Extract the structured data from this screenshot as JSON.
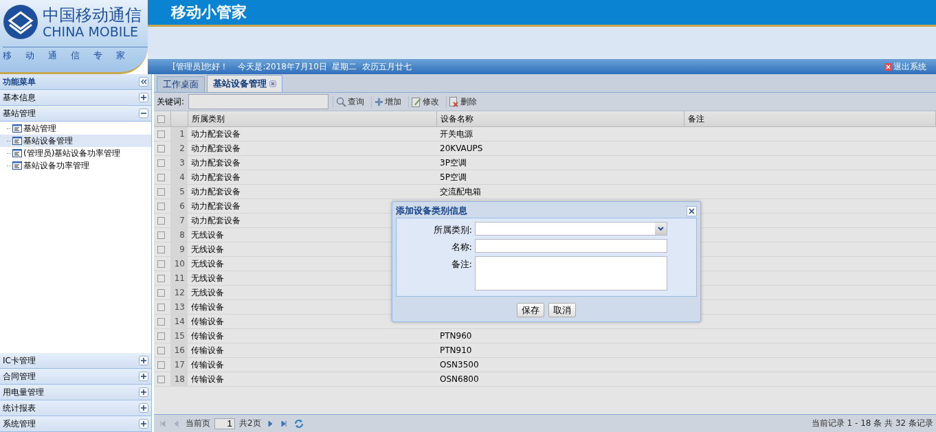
{
  "header": {
    "logo_cn": "中国移动通信",
    "logo_en": "CHINA MOBILE",
    "slogan": "移动通信专家",
    "app_title": "移动小管家",
    "greeting": "[管理员]您好！",
    "date": "今天是:2018年7月10日  星期二  农历五月廿七",
    "logout": "退出系统"
  },
  "sidebar": {
    "title": "功能菜单",
    "sections": [
      {
        "label": "基本信息",
        "expanded": false
      },
      {
        "label": "基站管理",
        "expanded": true,
        "children": [
          {
            "label": "基站管理",
            "selected": false
          },
          {
            "label": "基站设备管理",
            "selected": true
          },
          {
            "label": "(管理员)基站设备功率管理",
            "selected": false
          },
          {
            "label": "基站设备功率管理",
            "selected": false
          }
        ]
      },
      {
        "label": "IC卡管理",
        "expanded": false
      },
      {
        "label": "合同管理",
        "expanded": false
      },
      {
        "label": "用电量管理",
        "expanded": false
      },
      {
        "label": "统计报表",
        "expanded": false
      },
      {
        "label": "系统管理",
        "expanded": false
      }
    ]
  },
  "tabs": [
    {
      "label": "工作桌面",
      "selected": false,
      "closable": false
    },
    {
      "label": "基站设备管理",
      "selected": true,
      "closable": true
    }
  ],
  "toolbar": {
    "keyword_label": "关键词:",
    "buttons": [
      {
        "kind": "search",
        "label": "查询"
      },
      {
        "kind": "add",
        "label": "增加"
      },
      {
        "kind": "edit",
        "label": "修改"
      },
      {
        "kind": "delete",
        "label": "删除"
      }
    ]
  },
  "table": {
    "select_all_checked": false,
    "columns": [
      "所属类别",
      "设备名称",
      "备注"
    ],
    "rows": [
      {
        "index": "1",
        "category": "动力配套设备",
        "name": "开关电源",
        "checked": false
      },
      {
        "index": "2",
        "category": "动力配套设备",
        "name": "20KVAUPS",
        "checked": false
      },
      {
        "index": "3",
        "category": "动力配套设备",
        "name": "3P空调",
        "checked": false
      },
      {
        "index": "4",
        "category": "动力配套设备",
        "name": "5P空调",
        "checked": false
      },
      {
        "index": "5",
        "category": "动力配套设备",
        "name": "交流配电箱",
        "checked": false
      },
      {
        "index": "6",
        "category": "动力配套设备",
        "checked": false
      },
      {
        "index": "7",
        "category": "动力配套设备",
        "checked": false
      },
      {
        "index": "8",
        "category": "无线设备",
        "checked": false
      },
      {
        "index": "9",
        "category": "无线设备",
        "checked": false
      },
      {
        "index": "10",
        "category": "无线设备",
        "checked": false
      },
      {
        "index": "11",
        "category": "无线设备",
        "checked": false
      },
      {
        "index": "12",
        "category": "无线设备",
        "checked": false
      },
      {
        "index": "13",
        "category": "传输设备",
        "checked": false
      },
      {
        "index": "14",
        "category": "传输设备",
        "checked": false
      },
      {
        "index": "15",
        "category": "传输设备",
        "name": "PTN960",
        "checked": false
      },
      {
        "index": "16",
        "category": "传输设备",
        "name": "PTN910",
        "checked": false
      },
      {
        "index": "17",
        "category": "传输设备",
        "name": "OSN3500",
        "checked": false
      },
      {
        "index": "18",
        "category": "传输设备",
        "name": "OSN6800",
        "checked": false
      }
    ]
  },
  "pager": {
    "page_label": "当前页",
    "current_page": "1",
    "total_pages": "共2页",
    "summary": "当前记录 1 - 18 条 共 32 条记录"
  },
  "dialog": {
    "title": "添加设备类别信息",
    "fields": [
      {
        "label": "所属类别:",
        "kind": "select"
      },
      {
        "label": "名称:",
        "kind": "text"
      },
      {
        "label": "备注:",
        "kind": "textarea"
      }
    ],
    "buttons": [
      "保存",
      "取消"
    ]
  }
}
